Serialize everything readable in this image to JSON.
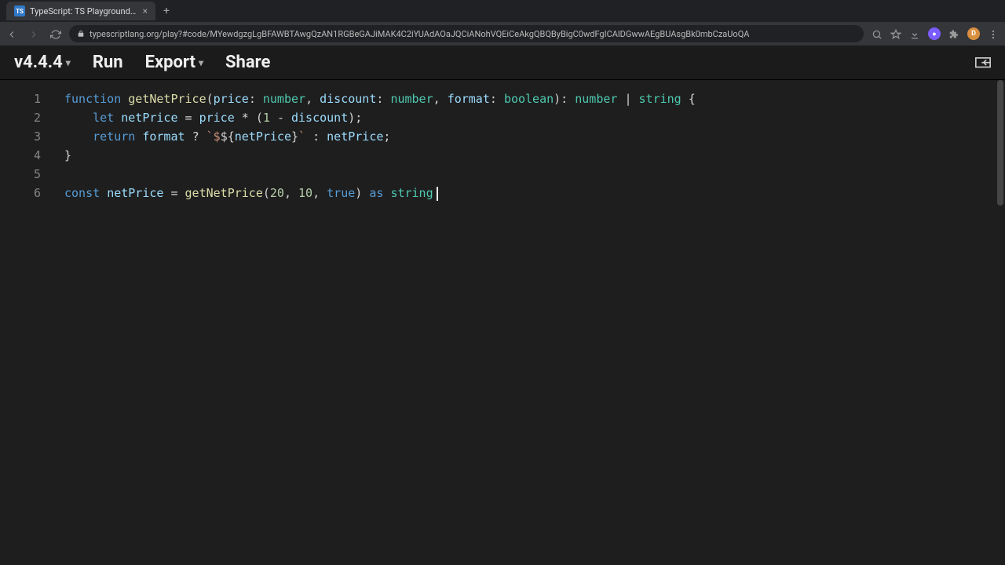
{
  "browser": {
    "tab_title": "TypeScript: TS Playground - A",
    "favicon_text": "TS",
    "url": "typescriptlang.org/play?#code/MYewdgzgLgBFAWBTAwgQzAN1RGBeGAJiMAK4C2iYUAdAOaJQCiANohVQEiCeAkgQBQByBigC0wdFgICAlDGwwAEgBUAsgBk0mbCzaUoQA"
  },
  "toolbar": {
    "version": "v4.4.4",
    "run": "Run",
    "export": "Export",
    "share": "Share"
  },
  "code": {
    "lines": [
      {
        "n": 1,
        "html": "<span class='kw'>function</span> <span class='fn'>getNetPrice</span><span class='punct'>(</span><span class='ident'>price</span><span class='punct'>:</span> <span class='type'>number</span><span class='punct'>,</span> <span class='ident'>discount</span><span class='punct'>:</span> <span class='type'>number</span><span class='punct'>,</span> <span class='ident'>format</span><span class='punct'>:</span> <span class='type'>boolean</span><span class='punct'>):</span> <span class='type'>number</span> <span class='punct'>|</span> <span class='type'>string</span> <span class='punct'>{</span>"
      },
      {
        "n": 2,
        "html": "    <span class='kw'>let</span> <span class='ident'>netPrice</span> <span class='punct'>=</span> <span class='ident'>price</span> <span class='punct'>*</span> <span class='punct'>(</span><span class='num'>1</span> <span class='punct'>-</span> <span class='ident'>discount</span><span class='punct'>);</span>"
      },
      {
        "n": 3,
        "html": "    <span class='kw'>return</span> <span class='ident'>format</span> <span class='punct'>?</span> <span class='str'>`$</span><span class='punct'>${</span><span class='ident'>netPrice</span><span class='punct'>}</span><span class='str'>`</span> <span class='punct'>:</span> <span class='ident'>netPrice</span><span class='punct'>;</span>"
      },
      {
        "n": 4,
        "html": "<span class='punct'>}</span>"
      },
      {
        "n": 5,
        "html": ""
      },
      {
        "n": 6,
        "html": "<span class='kw'>const</span> <span class='ident'>netPrice</span> <span class='punct'>=</span> <span class='fn'>getNetPrice</span><span class='punct'>(</span><span class='num'>20</span><span class='punct'>,</span> <span class='num'>10</span><span class='punct'>,</span> <span class='bool'>true</span><span class='punct'>)</span> <span class='kw'>as</span> <span class='type'>string</span><span class='cursor'></span>"
      }
    ]
  }
}
